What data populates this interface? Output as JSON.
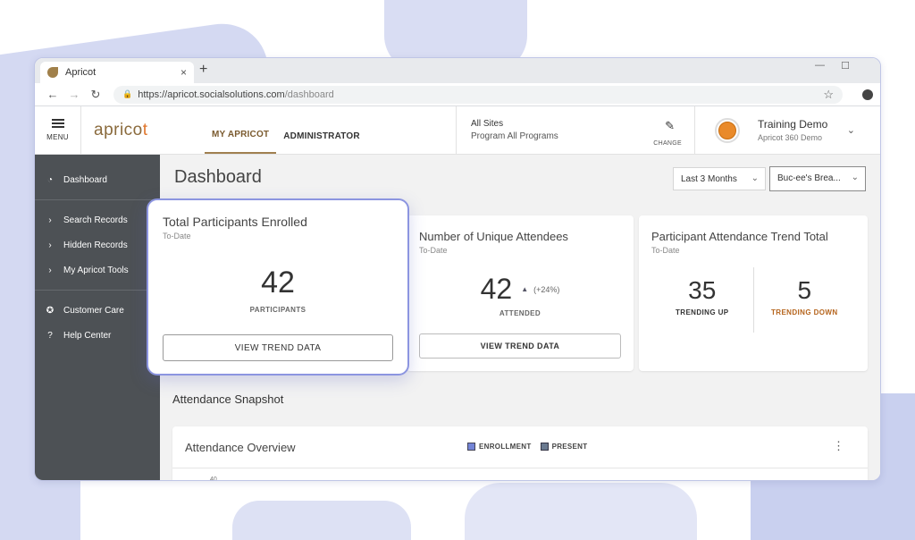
{
  "browser": {
    "tab_title": "Apricot",
    "tab_close": "×",
    "new_tab": "+",
    "minimize": "—",
    "maximize": "☐",
    "url_domain": "https://apricot.socialsolutions.com",
    "url_path": "/dashboard"
  },
  "header": {
    "menu_label": "MENU",
    "logo_text_pre": "aprico",
    "logo_text_dot": "t",
    "tabs": [
      {
        "label": "MY APRICOT",
        "active": true
      },
      {
        "label": "ADMINISTRATOR",
        "active": false
      }
    ],
    "site_line1": "All Sites",
    "site_line2": "Program All Programs",
    "change_label": "CHANGE",
    "user_name": "Training Demo",
    "user_sub": "Apricot 360 Demo"
  },
  "sidebar": {
    "items": [
      {
        "label": "Dashboard",
        "icon": "dashboard-icon"
      },
      {
        "label": "Search Records",
        "icon": "chevron-right-icon"
      },
      {
        "label": "Hidden Records",
        "icon": "chevron-right-icon"
      },
      {
        "label": "My Apricot Tools",
        "icon": "chevron-right-icon"
      },
      {
        "label": "Customer Care",
        "icon": "support-icon"
      },
      {
        "label": "Help Center",
        "icon": "help-icon"
      }
    ]
  },
  "main": {
    "title": "Dashboard",
    "date_filter": "Last 3 Months",
    "program_filter": "Buc-ee's Brea...",
    "cards": {
      "participants": {
        "title": "Total Participants Enrolled",
        "sub": "To-Date",
        "value": "42",
        "label": "PARTICIPANTS",
        "button": "VIEW TREND DATA"
      },
      "attendees": {
        "title": "Number of Unique Attendees",
        "sub": "To-Date",
        "value": "42",
        "change": "(+24%)",
        "label": "ATTENDED",
        "button": "VIEW TREND DATA"
      },
      "trend": {
        "title": "Participant Attendance Trend Total",
        "sub": "To-Date",
        "up_value": "35",
        "up_label": "TRENDING UP",
        "down_value": "5",
        "down_label": "TRENDING DOWN"
      }
    },
    "snapshot_title": "Attendance Snapshot",
    "overview": {
      "title": "Attendance Overview",
      "legend_enrollment": "ENROLLMENT",
      "legend_present": "PRESENT",
      "axis_first_tick": "40"
    }
  },
  "colors": {
    "brand": "#8a6a3c",
    "accent_blue": "#6c7fd8",
    "trend_down": "#b5641c",
    "sidebar_bg": "#4d5155",
    "highlight_border": "#8c95e0"
  }
}
